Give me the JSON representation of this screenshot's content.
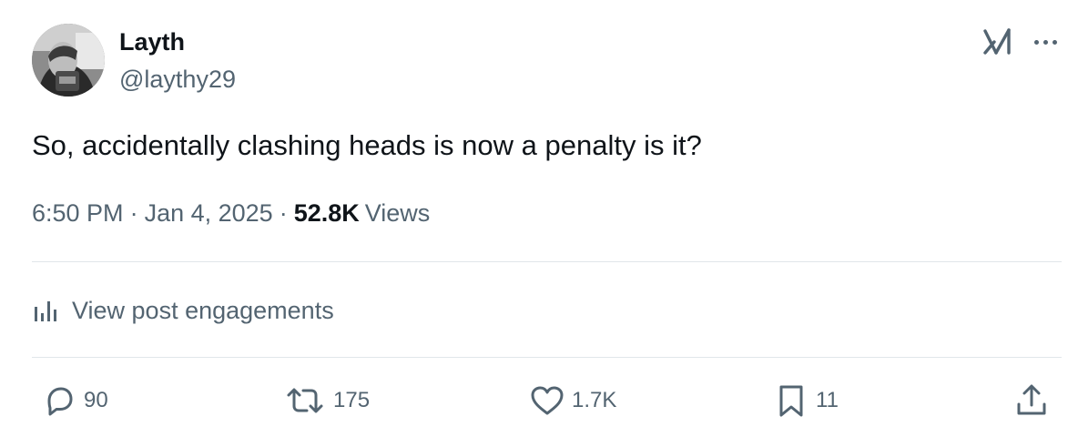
{
  "author": {
    "display_name": "Layth",
    "handle": "@laythy29"
  },
  "tweet": {
    "text": "So, accidentally clashing heads is now a penalty is it?",
    "time": "6:50 PM",
    "separator": "·",
    "date": "Jan 4, 2025",
    "views_count": "52.8K",
    "views_label": "Views"
  },
  "engagements": {
    "label": "View post engagements"
  },
  "actions": {
    "replies": "90",
    "reposts": "175",
    "likes": "1.7K",
    "bookmarks": "11"
  },
  "icons": {
    "grok": "grok-icon",
    "more": "more-icon",
    "analytics": "analytics-icon",
    "reply": "reply-icon",
    "repost": "repost-icon",
    "like": "like-icon",
    "bookmark": "bookmark-icon",
    "share": "share-icon"
  },
  "colors": {
    "text_primary": "#0f1419",
    "text_secondary": "#536471",
    "divider": "#e1e6ea"
  }
}
